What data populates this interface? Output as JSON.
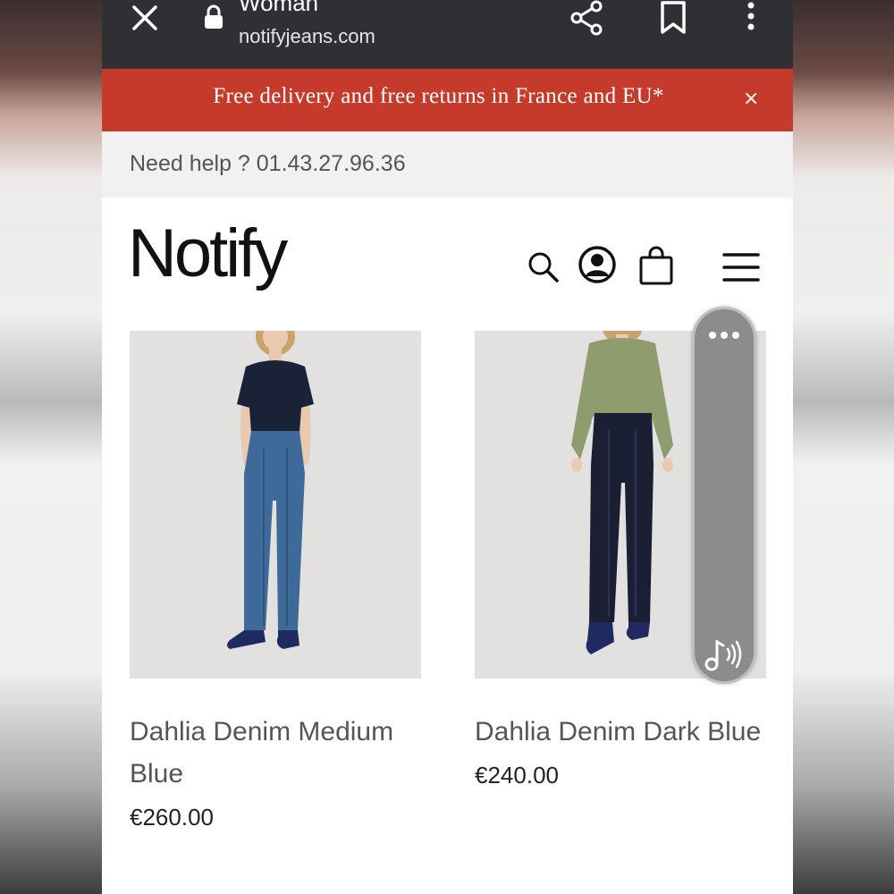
{
  "browser": {
    "title": "Woman",
    "url": "notifyjeans.com",
    "icons": [
      "close-icon",
      "lock-icon",
      "share-icon",
      "bookmark-icon",
      "more-vertical-icon"
    ]
  },
  "promo": {
    "text": "Free delivery and free returns in France and EU*",
    "close": "×",
    "color": "#c53a2b"
  },
  "help": {
    "text": "Need help ? 01.43.27.96.36"
  },
  "header": {
    "logo": "Notify",
    "icons": [
      "search-icon",
      "account-icon",
      "shopping-bag-icon",
      "hamburger-menu-icon"
    ]
  },
  "products": [
    {
      "name": "Dahlia Denim Medium Blue",
      "price": "€260.00",
      "top_color": "#1a2238",
      "jeans_color": "#3e6a99"
    },
    {
      "name": "Dahlia Denim Dark Blue",
      "price": "€240.00",
      "top_color": "#8f9c6e",
      "jeans_color": "#1a1f33"
    }
  ],
  "edge_panel": {
    "icons": [
      "more-horizontal-icon",
      "music-note-icon"
    ]
  }
}
